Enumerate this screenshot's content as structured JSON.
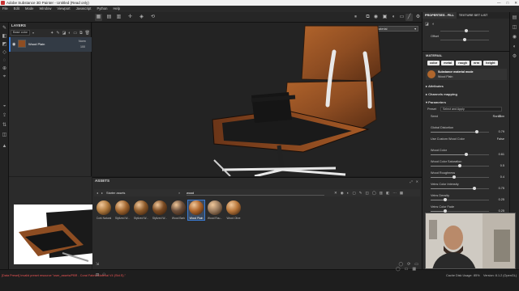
{
  "window": {
    "title": "Adobe Substance 3D Painter - Untitled (Read only)",
    "controls": [
      "—",
      "□",
      "✕"
    ]
  },
  "menu": [
    "File",
    "Edit",
    "Mode",
    "Window",
    "Viewport",
    "Javascript",
    "Python",
    "Help"
  ],
  "layers_panel": {
    "title": "LAYERS",
    "channel": "Base color",
    "layer": {
      "name": "Wood Plain",
      "blend": "Norm",
      "opacity": "100"
    }
  },
  "viewport": {
    "dropdown": "Material"
  },
  "assets_panel": {
    "title": "ASSETS",
    "breadcrumb": "Starter assets",
    "search_value": "wood",
    "materials": [
      {
        "label": "Cork Natural",
        "color": "#b07a3e"
      },
      {
        "label": "Stylized W...",
        "color": "#a0652f"
      },
      {
        "label": "Stylized W...",
        "color": "#8d5a2a"
      },
      {
        "label": "Stylized W...",
        "color": "#7a4a22"
      },
      {
        "label": "Wood Bark",
        "color": "#6b4e3a"
      },
      {
        "label": "Wood Plain",
        "color": "#b0662c"
      },
      {
        "label": "Wood Rou...",
        "color": "#9a7b5e"
      },
      {
        "label": "Wood Olive",
        "color": "#b8763a"
      }
    ],
    "selected_index": 5
  },
  "properties": {
    "tab_fill": "PROPERTIES - FILL",
    "tab_texture": "TEXTURE SET LIST",
    "offset_label": "Offset",
    "material_header": "MATERIAL",
    "channel_chips": [
      "color",
      "metal",
      "rough",
      "nrm",
      "height"
    ],
    "material_mode_title": "Substance material mode",
    "material_mode_value": "Wood Plain",
    "sections": [
      "Attributes",
      "Channels mapping",
      "Parameters"
    ],
    "preset_label": "Preset",
    "preset_value": "Select and Apply",
    "params": [
      {
        "label": "Seed",
        "value": "Random",
        "level": null
      },
      {
        "label": "Global Distortion",
        "value": "0.79",
        "level": 0.79
      },
      {
        "label": "Use Custom Wood Color",
        "value": "False",
        "level": null
      },
      {
        "label": "Wood Color",
        "value": "0.61",
        "level": 0.61
      },
      {
        "label": "Wood Color Saturation",
        "value": "0.5",
        "level": 0.5
      },
      {
        "label": "Wood Roughness",
        "value": "0.4",
        "level": 0.4
      },
      {
        "label": "Veins Color Intensity",
        "value": "0.75",
        "level": 0.75
      },
      {
        "label": "Veins Density",
        "value": "0.25",
        "level": 0.25
      },
      {
        "label": "Veins Color Fade",
        "value": "0.25",
        "level": 0.25
      },
      {
        "label": "Veins Thickness",
        "value": "",
        "level": null
      }
    ],
    "bottom_label": "Fibers Volume Blending"
  },
  "status": {
    "error": "[Data Preset] Invalid preset resource \"user_assets/PBR - Coral Fabric Material V4 (Std.S).\"",
    "cache": "Cache Disk Usage:",
    "cache_pct": "85%",
    "version": "Version: 8.1.2 (OpenGL)"
  },
  "colors": {
    "accent": "#3a7bd5",
    "panel": "#2b2b2b",
    "viewport_bg": "#232323",
    "wood": "#8e4d22"
  }
}
